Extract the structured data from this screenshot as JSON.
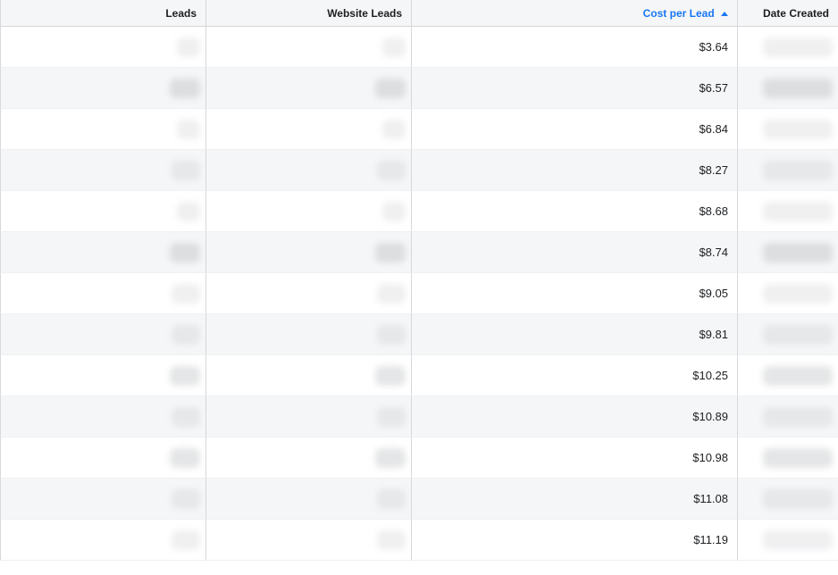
{
  "columns": {
    "leads": "Leads",
    "website_leads": "Website Leads",
    "cost_per_lead": "Cost per Lead",
    "date_created": "Date Created"
  },
  "sort": {
    "column": "cost_per_lead",
    "direction": "asc"
  },
  "rows": [
    {
      "cost_per_lead": "$3.64"
    },
    {
      "cost_per_lead": "$6.57"
    },
    {
      "cost_per_lead": "$6.84"
    },
    {
      "cost_per_lead": "$8.27"
    },
    {
      "cost_per_lead": "$8.68"
    },
    {
      "cost_per_lead": "$8.74"
    },
    {
      "cost_per_lead": "$9.05"
    },
    {
      "cost_per_lead": "$9.81"
    },
    {
      "cost_per_lead": "$10.25"
    },
    {
      "cost_per_lead": "$10.89"
    },
    {
      "cost_per_lead": "$10.98"
    },
    {
      "cost_per_lead": "$11.08"
    },
    {
      "cost_per_lead": "$11.19"
    }
  ]
}
